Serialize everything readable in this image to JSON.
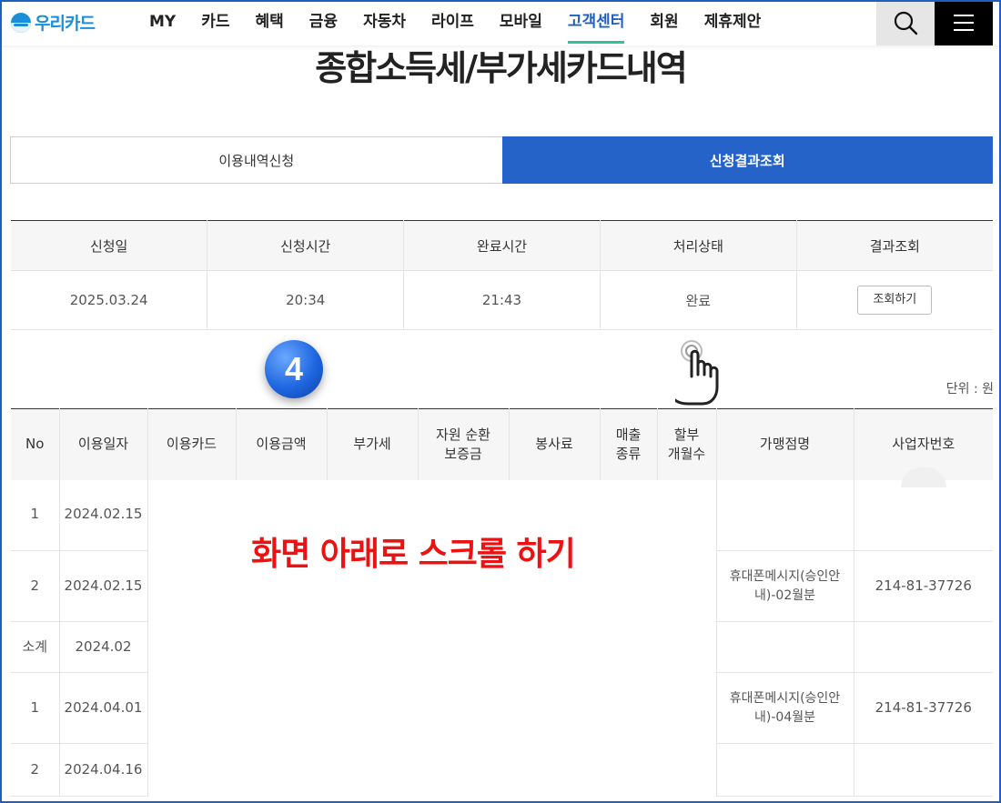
{
  "header": {
    "logo_text": "우리카드",
    "nav": [
      "MY",
      "카드",
      "혜택",
      "금융",
      "자동차",
      "라이프",
      "모바일",
      "고객센터",
      "회원",
      "제휴제안"
    ],
    "active_nav_index": 7,
    "search_icon": "search-icon",
    "menu_icon": "hamburger-menu-icon"
  },
  "page_title": "종합소득세/부가세카드내역",
  "tabs": {
    "apply": "이용내역신청",
    "result": "신청결과조회",
    "active": "result"
  },
  "result_table": {
    "headers": [
      "신청일",
      "신청시간",
      "완료시간",
      "처리상태",
      "결과조회"
    ],
    "row": {
      "date": "2025.03.24",
      "request_time": "20:34",
      "complete_time": "21:43",
      "status": "완료",
      "button": "조회하기"
    }
  },
  "step_badge": "4",
  "unit_label": "단위 : 원",
  "detail_table": {
    "headers": {
      "no": "No",
      "date": "이용일자",
      "card": "이용카드",
      "amount": "이용금액",
      "vat": "부가세",
      "deposit_1": "자원 순환",
      "deposit_2": "보증금",
      "service": "봉사료",
      "sales_1": "매출",
      "sales_2": "종류",
      "install_1": "할부",
      "install_2": "개월수",
      "merchant": "가맹점명",
      "bizno": "사업자번호"
    },
    "rows": [
      {
        "no": "1",
        "date": "2024.02.15",
        "merchant": "",
        "bizno": ""
      },
      {
        "no": "2",
        "date": "2024.02.15",
        "merchant": "휴대폰메시지(승인안내)-02월분",
        "bizno": "214-81-37726"
      },
      {
        "no": "소계",
        "date": "2024.02",
        "merchant": "",
        "bizno": ""
      },
      {
        "no": "1",
        "date": "2024.04.01",
        "merchant": "휴대폰메시지(승인안내)-04월분",
        "bizno": "214-81-37726"
      },
      {
        "no": "2",
        "date": "2024.04.16",
        "merchant": "",
        "bizno": ""
      }
    ]
  },
  "overlay_text": "화면 아래로 스크롤 하기",
  "colors": {
    "brand_blue": "#2563c9",
    "logo_blue": "#1a8fd8",
    "active_underline": "#2dc3a0",
    "overlay_red": "#ee1111"
  }
}
